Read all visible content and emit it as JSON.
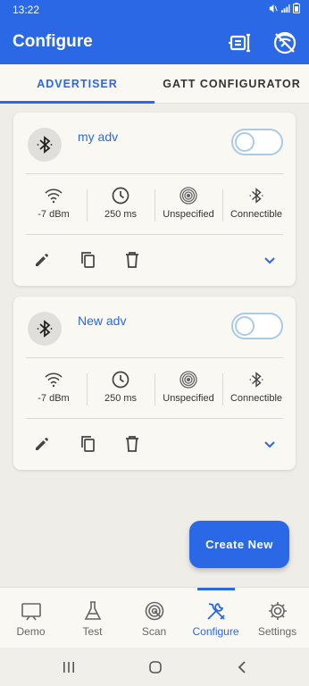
{
  "status_bar": {
    "time": "13:22"
  },
  "app_bar": {
    "title": "Configure"
  },
  "tabs": [
    {
      "label": "ADVERTISER"
    },
    {
      "label": "GATT CONFIGURATOR"
    }
  ],
  "cards": [
    {
      "name": "my adv",
      "enabled": false,
      "stats": {
        "tx_power": "-7 dBm",
        "interval": "250 ms",
        "type": "Unspecified",
        "mode": "Connectible"
      }
    },
    {
      "name": "New adv",
      "enabled": false,
      "stats": {
        "tx_power": "-7 dBm",
        "interval": "250 ms",
        "type": "Unspecified",
        "mode": "Connectible"
      }
    }
  ],
  "fab": {
    "label": "Create New"
  },
  "bottom_nav": [
    {
      "label": "Demo"
    },
    {
      "label": "Test"
    },
    {
      "label": "Scan"
    },
    {
      "label": "Configure"
    },
    {
      "label": "Settings"
    }
  ],
  "colors": {
    "primary": "#2a68e6",
    "toggle_border": "#a9cbe9",
    "background": "#efede8",
    "card": "#faf8f3"
  },
  "icons": {
    "app_bar": [
      "device-config-icon",
      "bluetooth-disabled-icon"
    ],
    "stats": [
      "wifi-icon",
      "clock-icon",
      "radio-icon",
      "bluetooth-icon"
    ],
    "card_actions": [
      "edit-icon",
      "copy-icon",
      "delete-icon",
      "chevron-down-icon"
    ]
  }
}
